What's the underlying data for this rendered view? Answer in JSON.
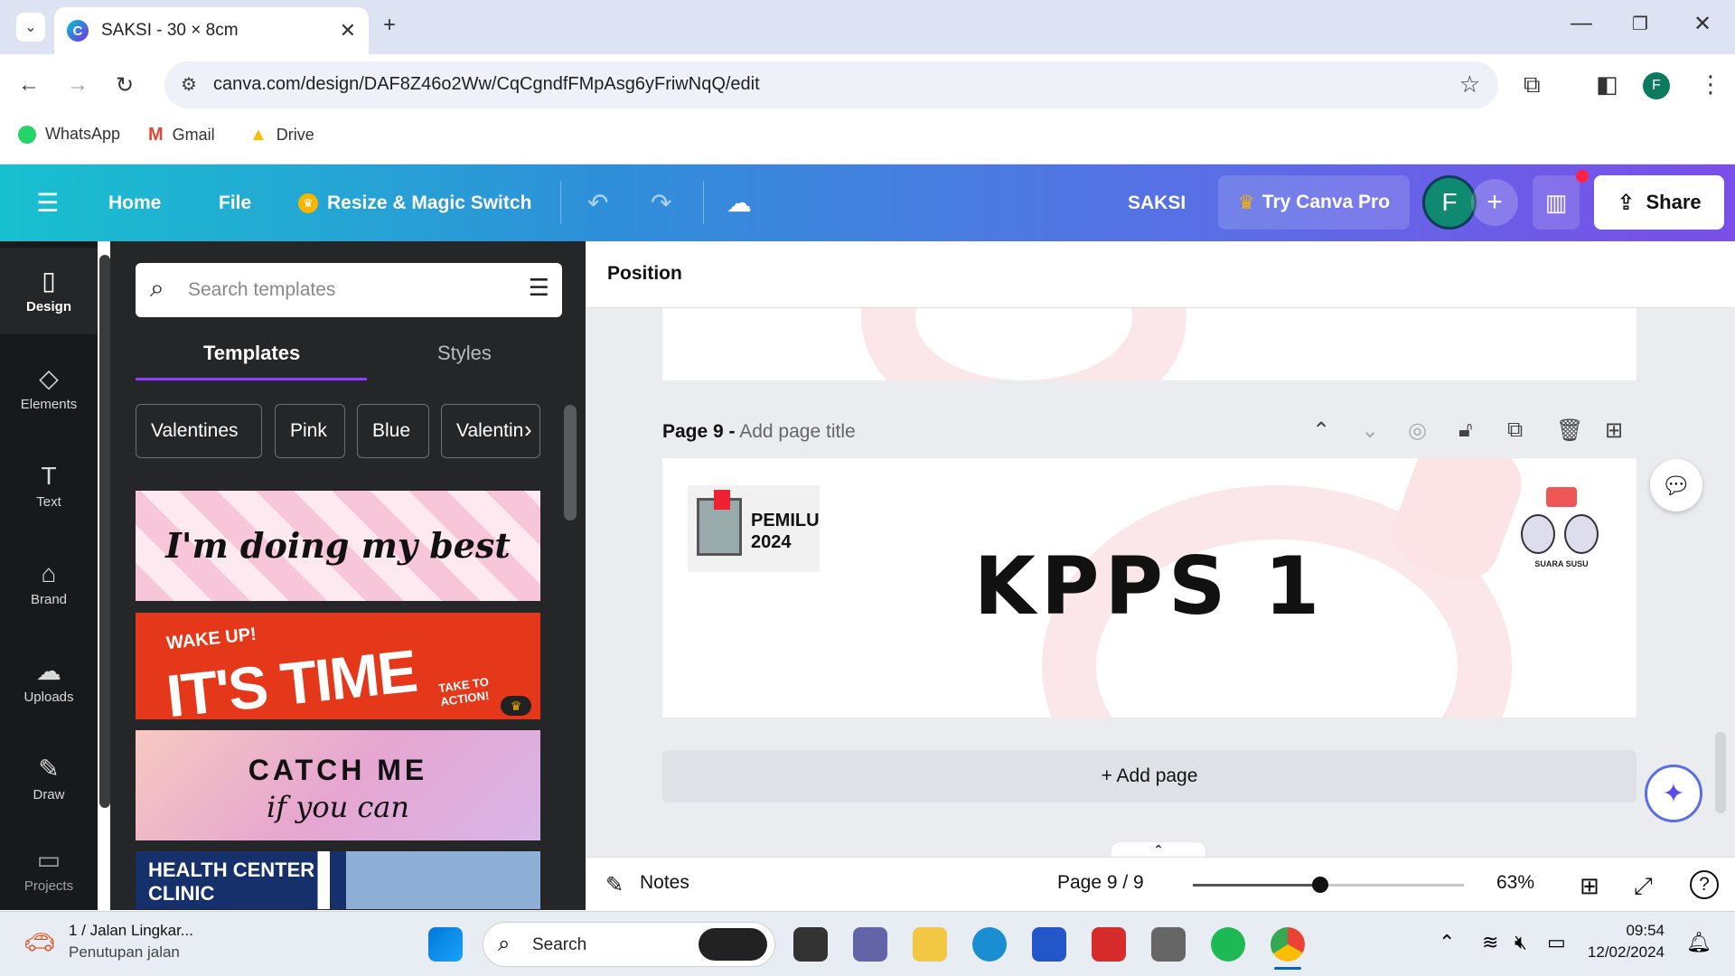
{
  "browser": {
    "tab_title": "SAKSI - 30 × 8cm",
    "url": "canva.com/design/DAF8Z46o2Ww/CqCgndfFMpAsg6yFriwNqQ/edit",
    "profile_initial": "F",
    "bookmarks": [
      {
        "label": "WhatsApp"
      },
      {
        "label": "Gmail"
      },
      {
        "label": "Drive"
      }
    ]
  },
  "header": {
    "menu_home": "Home",
    "menu_file": "File",
    "resize": "Resize & Magic Switch",
    "doc_title": "SAKSI",
    "try_pro": "Try Canva Pro",
    "avatar": "F",
    "share": "Share"
  },
  "rail": {
    "items": [
      {
        "label": "Design",
        "icon": "▯"
      },
      {
        "label": "Elements",
        "icon": "◇"
      },
      {
        "label": "Text",
        "icon": "T"
      },
      {
        "label": "Brand",
        "icon": "⌂"
      },
      {
        "label": "Uploads",
        "icon": "☁"
      },
      {
        "label": "Draw",
        "icon": "✎"
      },
      {
        "label": "Projects",
        "icon": "▭"
      }
    ]
  },
  "panel": {
    "search_placeholder": "Search templates",
    "tab_templates": "Templates",
    "tab_styles": "Styles",
    "chips": [
      "Valentines",
      "Pink",
      "Blue",
      "Valentin"
    ],
    "templates": [
      {
        "text": "I'm doing my best"
      },
      {
        "text1": "WAKE UP!",
        "text2": "IT'S TIME",
        "text3": "TAKE TO ACTION!"
      },
      {
        "text1": "CATCH ME",
        "text2": "if you can"
      },
      {
        "text1": "HEALTH CENTER",
        "text2": "CLINIC"
      }
    ]
  },
  "editor": {
    "position_label": "Position",
    "page_label": "Page 9 -",
    "page_title_placeholder": "Add page title",
    "canvas_text": "KPPS 1",
    "logo_text1": "PEMILU",
    "logo_text2": "2024",
    "mascot_text": "SUARA SUSU",
    "add_page": "+ Add page",
    "notes": "Notes",
    "page_indicator": "Page 9 / 9",
    "zoom": "63%",
    "zoom_level": 0.47
  },
  "taskbar": {
    "notif_title": "1 / Jalan Lingkar...",
    "notif_sub": "Penutupan jalan",
    "search": "Search",
    "time": "09:54",
    "date": "12/02/2024"
  }
}
